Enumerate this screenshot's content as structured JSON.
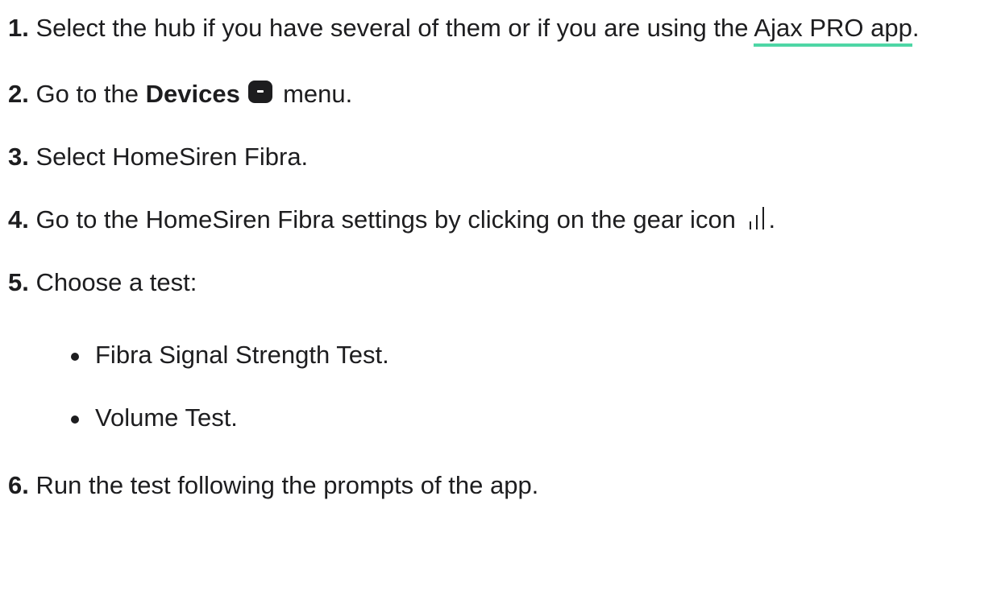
{
  "steps": [
    {
      "number": "1.",
      "text_before": "Select the hub if you have several of them or if you are using the ",
      "link_text": "Ajax PRO app",
      "text_after": "."
    },
    {
      "number": "2.",
      "text_before": "Go to the ",
      "bold_text": "Devices",
      "icon": "devices-icon",
      "text_after": " menu."
    },
    {
      "number": "3.",
      "text": "Select HomeSiren Fibra."
    },
    {
      "number": "4.",
      "text_before": "Go to the HomeSiren Fibra settings by clicking on the gear icon ",
      "icon": "gear-icon",
      "text_after": "."
    },
    {
      "number": "5.",
      "text": "Choose a test:",
      "options": [
        "Fibra Signal Strength Test.",
        "Volume Test."
      ]
    },
    {
      "number": "6.",
      "text": "Run the test following the prompts of the app."
    }
  ],
  "colors": {
    "text": "#1d1d1f",
    "link_underline": "#4ed6a5"
  }
}
